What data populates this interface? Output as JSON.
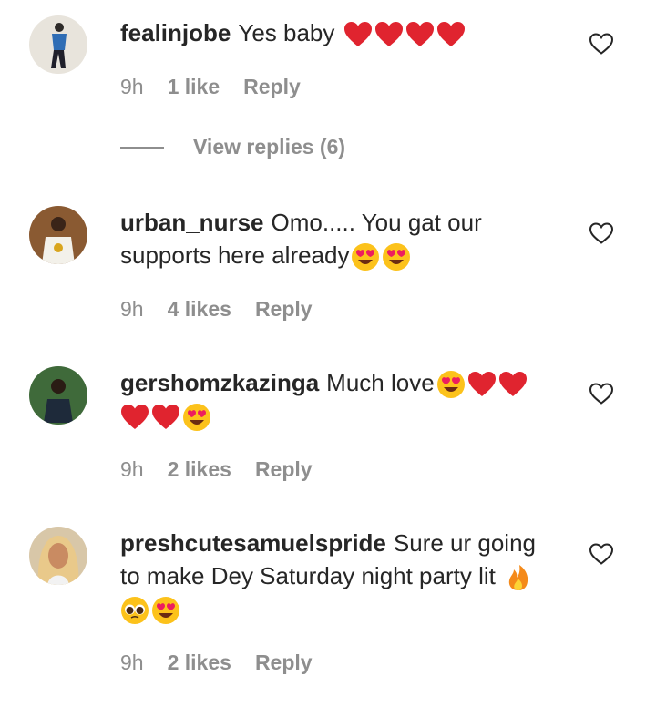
{
  "comments": [
    {
      "username": "fealinjobe",
      "text": "Yes baby",
      "emojis": [
        "red-heart",
        "red-heart",
        "red-heart",
        "red-heart"
      ],
      "time": "9h",
      "likes": "1 like",
      "reply": "Reply"
    },
    {
      "username": "urban_nurse",
      "text": "Omo..... You gat our supports here already",
      "emojis": [
        "heart-eyes",
        "heart-eyes"
      ],
      "time": "9h",
      "likes": "4 likes",
      "reply": "Reply"
    },
    {
      "username": "gershomzkazinga",
      "text": "Much love",
      "emojis": [
        "heart-eyes",
        "red-heart",
        "red-heart",
        "red-heart",
        "red-heart",
        "heart-eyes"
      ],
      "time": "9h",
      "likes": "2 likes",
      "reply": "Reply"
    },
    {
      "username": "preshcutesamuelspride",
      "text": "Sure ur going to make Dey Saturday night party lit",
      "emojis": [
        "fire",
        "pleading-face",
        "heart-eyes"
      ],
      "time": "9h",
      "likes": "2 likes",
      "reply": "Reply"
    }
  ],
  "view_replies": "View replies (6)",
  "icons": {
    "like": "heart-outline-icon"
  },
  "colors": {
    "text": "#262626",
    "muted": "#8e8e8e",
    "heart": "#e0242f"
  }
}
